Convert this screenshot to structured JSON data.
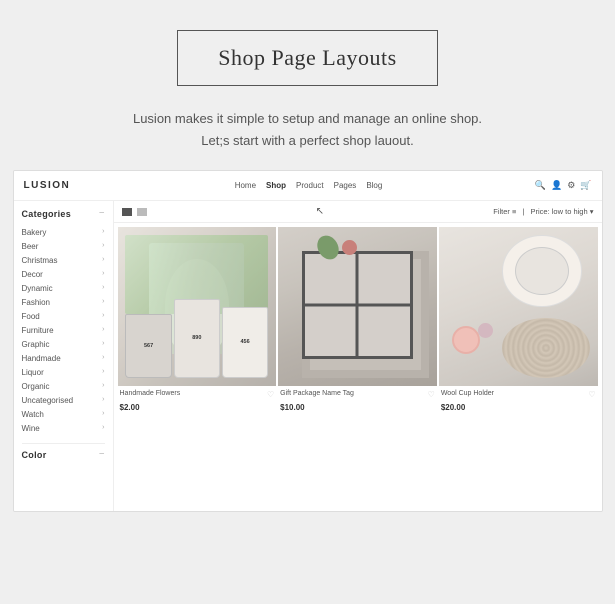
{
  "page": {
    "background_color": "#efefef"
  },
  "header": {
    "title": "Shop Page Layouts",
    "subtitle_line1": "Lusion makes it simple to setup and manage an online shop.",
    "subtitle_line2": "Let;s start with a perfect shop lauout."
  },
  "nav": {
    "logo": "LUSION",
    "links": [
      "Home",
      "Shop",
      "Product",
      "Pages",
      "Blog"
    ],
    "active_link": "Shop"
  },
  "sidebar": {
    "title": "Categories",
    "items": [
      "Bakery",
      "Beer",
      "Christmas",
      "Decor",
      "Dynamic",
      "Fashion",
      "Food",
      "Furniture",
      "Graphic",
      "Handmade",
      "Liquor",
      "Organic",
      "Uncategorised",
      "Watch",
      "Wine"
    ],
    "color_section_label": "Color"
  },
  "toolbar": {
    "filter_label": "Filter",
    "sort_label": "Price: low to high"
  },
  "products": [
    {
      "name": "Handmade Flowers",
      "price": "$2.00",
      "image_type": "flowers"
    },
    {
      "name": "Gift Package Name Tag",
      "price": "$10.00",
      "image_type": "gift"
    },
    {
      "name": "Wool Cup Holder",
      "price": "$20.00",
      "image_type": "wool"
    }
  ]
}
